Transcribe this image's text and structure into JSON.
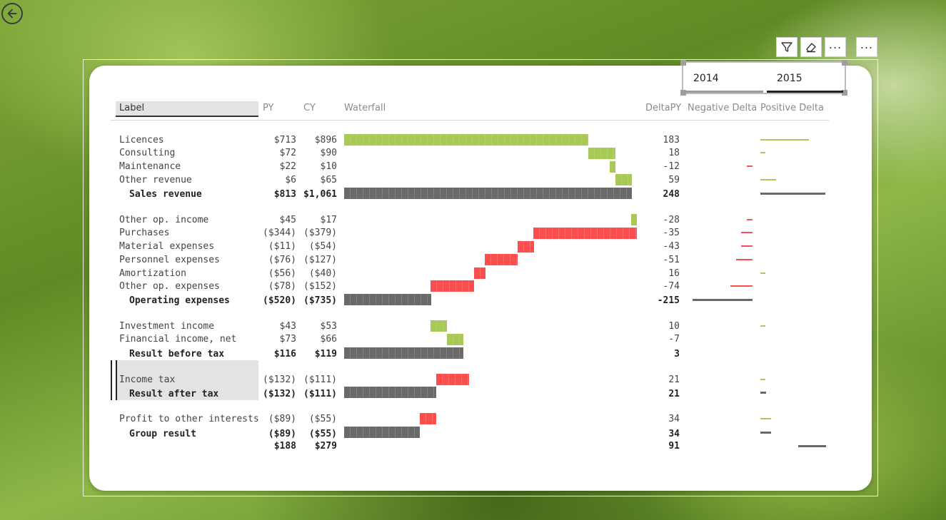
{
  "nav": {
    "back_icon": "back-arrow-icon"
  },
  "toolbar": {
    "filter_icon": "filter-icon",
    "eraser_icon": "eraser-icon",
    "more_label": "...",
    "more2_label": "..."
  },
  "slicer": {
    "options": [
      "2014",
      "2015"
    ],
    "selected": "2015"
  },
  "table": {
    "headers": {
      "label": "Label",
      "py": "PY",
      "cy": "CY",
      "waterfall": "Waterfall",
      "delta": "DeltaPY",
      "neg": "Negative Delta",
      "pos": "Positive Delta"
    },
    "rows": [
      {
        "label": "Licences",
        "py": "$713",
        "cy": "$896",
        "delta": "183"
      },
      {
        "label": "Consulting",
        "py": "$72",
        "cy": "$90",
        "delta": "18"
      },
      {
        "label": "Maintenance",
        "py": "$22",
        "cy": "$10",
        "delta": "-12"
      },
      {
        "label": "Other revenue",
        "py": "$6",
        "cy": "$65",
        "delta": "59"
      },
      {
        "label": "Sales revenue",
        "py": "$813",
        "cy": "$1,061",
        "delta": "248"
      },
      {
        "label": "Other op. income",
        "py": "$45",
        "cy": "$17",
        "delta": "-28"
      },
      {
        "label": "Purchases",
        "py": "($344)",
        "cy": "($379)",
        "delta": "-35"
      },
      {
        "label": "Material expenses",
        "py": "($11)",
        "cy": "($54)",
        "delta": "-43"
      },
      {
        "label": "Personnel expenses",
        "py": "($76)",
        "cy": "($127)",
        "delta": "-51"
      },
      {
        "label": "Amortization",
        "py": "($56)",
        "cy": "($40)",
        "delta": "16"
      },
      {
        "label": "Other op. expenses",
        "py": "($78)",
        "cy": "($152)",
        "delta": "-74"
      },
      {
        "label": "Operating expenses",
        "py": "($520)",
        "cy": "($735)",
        "delta": "-215"
      },
      {
        "label": "Investment income",
        "py": "$43",
        "cy": "$53",
        "delta": "10"
      },
      {
        "label": "Financial income, net",
        "py": "$73",
        "cy": "$66",
        "delta": "-7"
      },
      {
        "label": "Result before tax",
        "py": "$116",
        "cy": "$119",
        "delta": "3"
      },
      {
        "label": "Income tax",
        "py": "($132)",
        "cy": "($111)",
        "delta": "21"
      },
      {
        "label": "Result after tax",
        "py": "($132)",
        "cy": "($111)",
        "delta": "21"
      },
      {
        "label": "Profit to other interests",
        "py": "($89)",
        "cy": "($55)",
        "delta": "34"
      },
      {
        "label": "Group result",
        "py": "($89)",
        "cy": "($55)",
        "delta": "34"
      },
      {
        "label": "",
        "py": "$188",
        "cy": "$279",
        "delta": "91"
      }
    ]
  },
  "colors": {
    "positive": "#a8c957",
    "negative": "#fb4e4e",
    "total": "#6a6a6a"
  }
}
